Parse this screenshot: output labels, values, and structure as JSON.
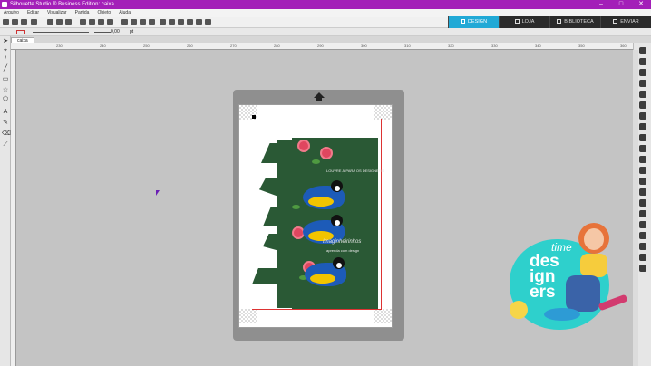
{
  "titlebar": {
    "title": "Silhouette Studio ® Business Edition: caixa"
  },
  "window_controls": {
    "minimize": "–",
    "maximize": "□",
    "close": "✕"
  },
  "menu": [
    "Arquivo",
    "Editar",
    "Visualizar",
    "Partida",
    "Objeto",
    "Ajuda"
  ],
  "tabs": [
    {
      "label": "DESIGN",
      "active": true
    },
    {
      "label": "LOJA",
      "active": false
    },
    {
      "label": "BIBLIOTECA",
      "active": false
    },
    {
      "label": "ENVIAR",
      "active": false
    }
  ],
  "props": {
    "line_value": "0,00",
    "unit": "pt"
  },
  "document": {
    "tab_label": "caixa"
  },
  "ruler_ticks": [
    "230",
    "240",
    "250",
    "260",
    "270",
    "280",
    "290",
    "300",
    "310",
    "320",
    "330",
    "340",
    "350",
    "360"
  ],
  "design": {
    "card_text": "LOUVRE À PARA OS DESIGNERS",
    "script_text": "Imaginheirinhos",
    "small_text": "aprenda com design"
  },
  "logo": {
    "line1": "time",
    "line2": "des",
    "line3": "ign",
    "line4": "ers"
  },
  "colors": {
    "accent": "#21a9d6",
    "titlebar": "#a31fb8",
    "card": "#2a5935"
  }
}
